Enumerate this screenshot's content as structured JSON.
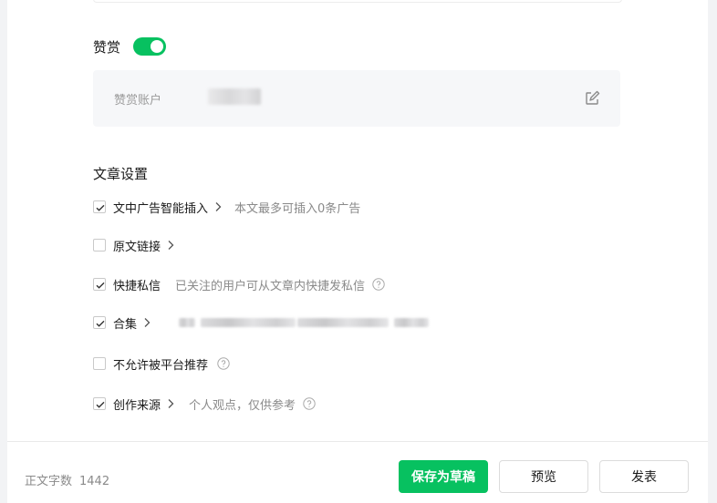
{
  "reward": {
    "label": "赞赏",
    "enabled": true,
    "account_label": "赞赏账户"
  },
  "article_settings": {
    "title": "文章设置",
    "options": [
      {
        "label": "文中广告智能插入",
        "checked": true,
        "has_chevron": true,
        "desc": "本文最多可插入0条广告"
      },
      {
        "label": "原文链接",
        "checked": false,
        "has_chevron": true,
        "desc": ""
      },
      {
        "label": "快捷私信",
        "checked": true,
        "has_chevron": false,
        "desc": "已关注的用户可从文章内快捷发私信"
      },
      {
        "label": "合集",
        "checked": true,
        "has_chevron": true,
        "desc": ""
      },
      {
        "label": "不允许被平台推荐",
        "checked": false,
        "has_chevron": false,
        "desc": ""
      },
      {
        "label": "创作来源",
        "checked": true,
        "has_chevron": true,
        "desc": "个人观点，仅供参考"
      }
    ]
  },
  "footer": {
    "word_count_label": "正文字数",
    "word_count": "1442",
    "save_draft_label": "保存为草稿",
    "preview_label": "预览",
    "publish_label": "发表"
  },
  "colors": {
    "accent": "#07c160",
    "muted_text": "#8a8a8a",
    "panel_bg": "#f6f7f9"
  },
  "icons": [
    "edit-icon",
    "checkbox-check-icon",
    "chevron-right-icon",
    "help-circle-icon"
  ]
}
